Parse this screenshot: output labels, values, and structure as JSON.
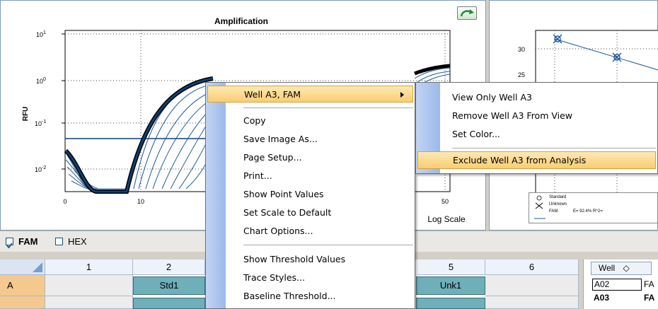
{
  "amplification": {
    "title": "Amplification",
    "y_axis_label": "RFU",
    "y_ticks": [
      {
        "base": "10",
        "exp": "1"
      },
      {
        "base": "10",
        "exp": "0"
      },
      {
        "base": "10",
        "exp": "-1"
      },
      {
        "base": "10",
        "exp": "-2"
      }
    ],
    "x_ticks": [
      "0",
      "10",
      "50"
    ],
    "scale_option": "Log Scale"
  },
  "standard_curve": {
    "y_ticks": [
      "30",
      "25"
    ],
    "legend": {
      "standard": "Standard",
      "unknown": "Unknown",
      "fam": "FAM",
      "efficiency": "E= 92.4% R^2="
    }
  },
  "fluorophores": [
    {
      "label": "FAM",
      "checked": true
    },
    {
      "label": "HEX",
      "checked": false
    }
  ],
  "plate": {
    "columns": [
      "1",
      "2",
      "5",
      "6"
    ],
    "row_label": "A",
    "cells": {
      "a2": "Std1",
      "a5": "Unk1"
    }
  },
  "well_table": {
    "header": "Well",
    "sort_glyph": "◇",
    "rows": [
      {
        "well": "A02",
        "fluor": "FA"
      },
      {
        "well": "A03",
        "fluor": "FA"
      }
    ]
  },
  "context_menu": {
    "header_item": "Well A3, FAM",
    "items": [
      "Copy",
      "Save Image As...",
      "Page Setup...",
      "Print...",
      "Show Point Values",
      "Set Scale to Default",
      "Chart Options..."
    ],
    "items2": [
      "Show Threshold Values",
      "Trace Styles...",
      "Baseline Threshold..."
    ]
  },
  "submenu": {
    "items": [
      "View Only Well A3",
      "Remove Well A3 From View",
      "Set Color..."
    ],
    "highlighted": "Exclude Well A3 from Analysis"
  },
  "colors": {
    "trace": "#0e3f72",
    "menu_highlight": "#f9cd71",
    "filled_well": "#6fafb9",
    "row_header": "#f4c88f"
  }
}
